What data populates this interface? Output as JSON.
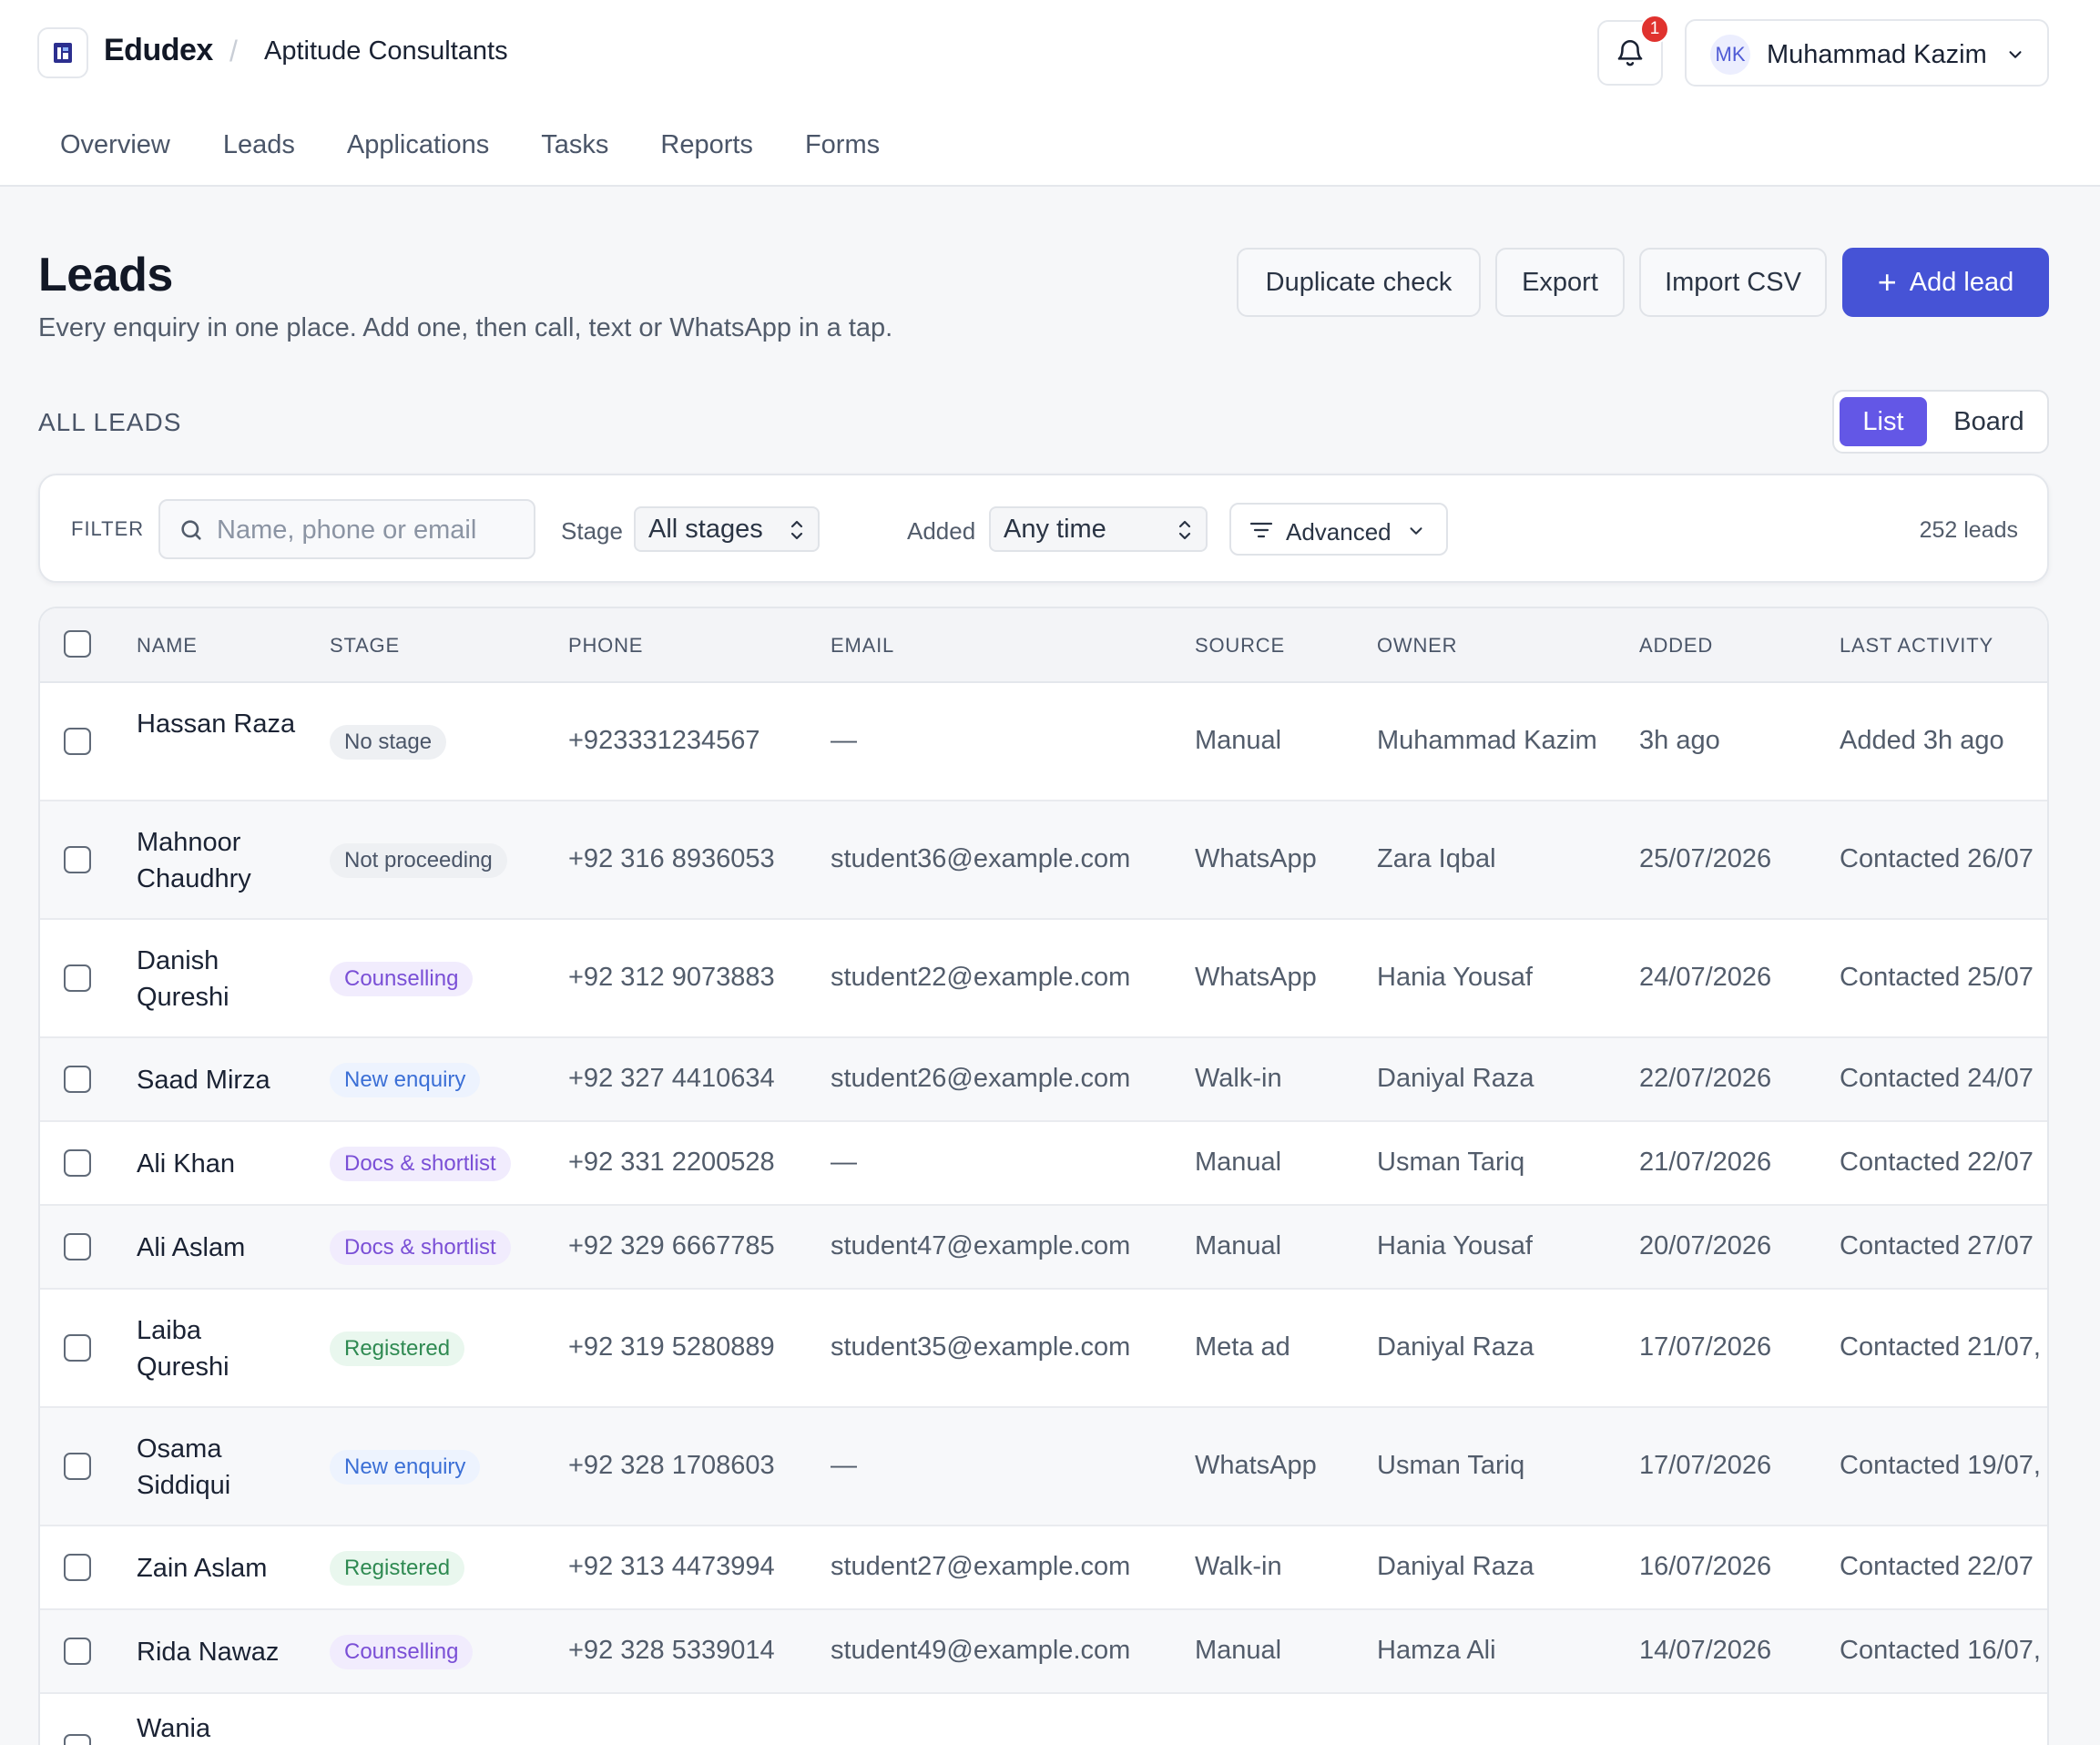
{
  "header": {
    "brand": "Edudex",
    "separator": "/",
    "org": "Aptitude Consultants",
    "notification_count": "1",
    "user_initials": "MK",
    "user_name": "Muhammad Kazim"
  },
  "nav": [
    "Overview",
    "Leads",
    "Applications",
    "Tasks",
    "Reports",
    "Forms"
  ],
  "page": {
    "title": "Leads",
    "subtitle": "Every enquiry in one place. Add one, then call, text or WhatsApp in a tap.",
    "buttons": {
      "duplicate": "Duplicate check",
      "export": "Export",
      "import": "Import CSV",
      "add": "Add lead"
    },
    "section_label": "ALL LEADS",
    "view_toggle": {
      "list": "List",
      "board": "Board",
      "selected": "List"
    }
  },
  "filter": {
    "label": "FILTER",
    "search_placeholder": "Name, phone or email",
    "stage_label": "Stage",
    "stage_value": "All stages",
    "added_label": "Added",
    "added_value": "Any time",
    "advanced": "Advanced",
    "count": "252 leads"
  },
  "table": {
    "columns": [
      "NAME",
      "STAGE",
      "PHONE",
      "EMAIL",
      "SOURCE",
      "OWNER",
      "ADDED",
      "LAST ACTIVITY"
    ],
    "rows": [
      {
        "name": "Hassan Raza",
        "stage": "No stage",
        "stage_kind": "none",
        "phone": "+923331234567",
        "email": "—",
        "source": "Manual",
        "owner": "Muhammad Kazim",
        "added": "3h ago",
        "last": "Added 3h ago"
      },
      {
        "name": "Mahnoor Chaudhry",
        "stage": "Not proceeding",
        "stage_kind": "none",
        "phone": "+92 316 8936053",
        "email": "student36@example.com",
        "source": "WhatsApp",
        "owner": "Zara Iqbal",
        "added": "25/07/2026",
        "last": "Contacted 26/07"
      },
      {
        "name": "Danish Qureshi",
        "stage": "Counselling",
        "stage_kind": "purple",
        "phone": "+92 312 9073883",
        "email": "student22@example.com",
        "source": "WhatsApp",
        "owner": "Hania Yousaf",
        "added": "24/07/2026",
        "last": "Contacted 25/07"
      },
      {
        "name": "Saad Mirza",
        "stage": "New enquiry",
        "stage_kind": "blue",
        "phone": "+92 327 4410634",
        "email": "student26@example.com",
        "source": "Walk-in",
        "owner": "Daniyal Raza",
        "added": "22/07/2026",
        "last": "Contacted 24/07"
      },
      {
        "name": "Ali Khan",
        "stage": "Docs & shortlist",
        "stage_kind": "violet",
        "phone": "+92 331 2200528",
        "email": "—",
        "source": "Manual",
        "owner": "Usman Tariq",
        "added": "21/07/2026",
        "last": "Contacted 22/07"
      },
      {
        "name": "Ali Aslam",
        "stage": "Docs & shortlist",
        "stage_kind": "violet",
        "phone": "+92 329 6667785",
        "email": "student47@example.com",
        "source": "Manual",
        "owner": "Hania Yousaf",
        "added": "20/07/2026",
        "last": "Contacted 27/07"
      },
      {
        "name": "Laiba Qureshi",
        "stage": "Registered",
        "stage_kind": "green",
        "phone": "+92 319 5280889",
        "email": "student35@example.com",
        "source": "Meta ad",
        "owner": "Daniyal Raza",
        "added": "17/07/2026",
        "last": "Contacted 21/07,"
      },
      {
        "name": "Osama Siddiqui",
        "stage": "New enquiry",
        "stage_kind": "blue",
        "phone": "+92 328 1708603",
        "email": "—",
        "source": "WhatsApp",
        "owner": "Usman Tariq",
        "added": "17/07/2026",
        "last": "Contacted 19/07,"
      },
      {
        "name": "Zain Aslam",
        "stage": "Registered",
        "stage_kind": "green",
        "phone": "+92 313 4473994",
        "email": "student27@example.com",
        "source": "Walk-in",
        "owner": "Daniyal Raza",
        "added": "16/07/2026",
        "last": "Contacted 22/07"
      },
      {
        "name": "Rida Nawaz",
        "stage": "Counselling",
        "stage_kind": "purple",
        "phone": "+92 328 5339014",
        "email": "student49@example.com",
        "source": "Manual",
        "owner": "Hamza Ali",
        "added": "14/07/2026",
        "last": "Contacted 16/07,"
      },
      {
        "name": "Wania",
        "stage": "",
        "stage_kind": "none",
        "phone": "",
        "email": "",
        "source": "",
        "owner": "",
        "added": "",
        "last": ""
      }
    ]
  },
  "colors": {
    "accent": "#4653d6",
    "toggle_active": "#6357e6",
    "badge": "#e0322e",
    "pill_none": [
      "#eef0f3",
      "#4a5568"
    ],
    "pill_purple": [
      "#f1ecfd",
      "#7a4fd6"
    ],
    "pill_violet": [
      "#f1ecfd",
      "#7a4fd6"
    ],
    "pill_blue": [
      "#edf3fe",
      "#3b6fd6"
    ],
    "pill_green": [
      "#e9f7ee",
      "#2f8a52"
    ]
  }
}
